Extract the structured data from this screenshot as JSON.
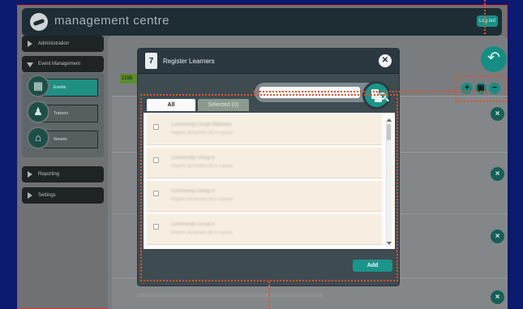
{
  "app": {
    "title": "management centre",
    "logout_label": "Log out"
  },
  "sidebar": {
    "sections": [
      {
        "label": "Administration",
        "expanded": false
      },
      {
        "label": "Event Management",
        "expanded": true
      },
      {
        "label": "Reporting",
        "expanded": false
      },
      {
        "label": "Settings",
        "expanded": false
      }
    ],
    "subitems": [
      {
        "label": "Events",
        "icon": "calendar-icon",
        "active": true
      },
      {
        "label": "Trainers",
        "icon": "trainer-icon",
        "active": false
      },
      {
        "label": "Venues",
        "icon": "venue-icon",
        "active": false
      }
    ]
  },
  "content": {
    "chip": "2296"
  },
  "modal": {
    "title": "Register Learners",
    "icon": "register-icon",
    "search_placeholder": "",
    "tabs": [
      {
        "label": "All",
        "active": true
      },
      {
        "label": "Selected (0)",
        "active": false
      }
    ],
    "items": [
      {
        "title": "Community Group Wellness",
        "subtitle": "Register all learners (8) in a group"
      },
      {
        "title": "Community Group 6",
        "subtitle": "Register all learners (8) in a group"
      },
      {
        "title": "Community Group 5",
        "subtitle": "Register all learners (8) in a group"
      },
      {
        "title": "Community Group 4",
        "subtitle": "Register all learners (8) in a group"
      }
    ],
    "add_label": "Add"
  },
  "colors": {
    "accent": "#1b948a",
    "annotation": "#e0532f",
    "topbar": "#1e2d33"
  }
}
